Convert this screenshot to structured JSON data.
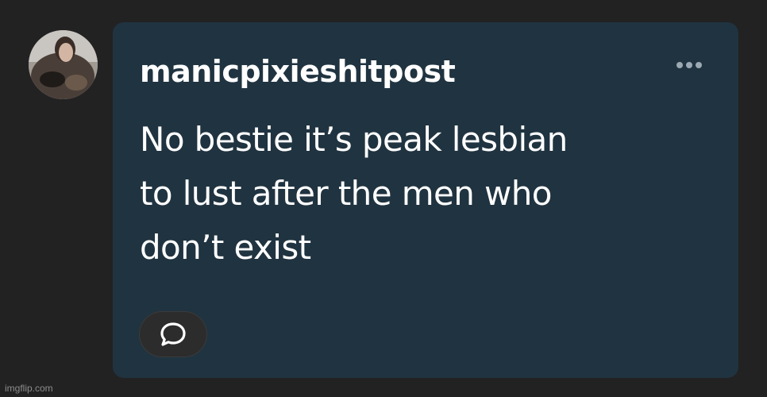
{
  "post": {
    "username": "manicpixieshitpost",
    "body_lines": [
      "No bestie it’s peak lesbian",
      "to lust after the men who",
      "don’t exist"
    ]
  },
  "icons": {
    "more": "more-horizontal-icon",
    "reply": "speech-bubble-icon"
  },
  "watermark": "imgflip.com",
  "colors": {
    "page_background": "#222223",
    "card_background": "#203340",
    "text": "#ffffff",
    "muted": "#9da9b2"
  }
}
